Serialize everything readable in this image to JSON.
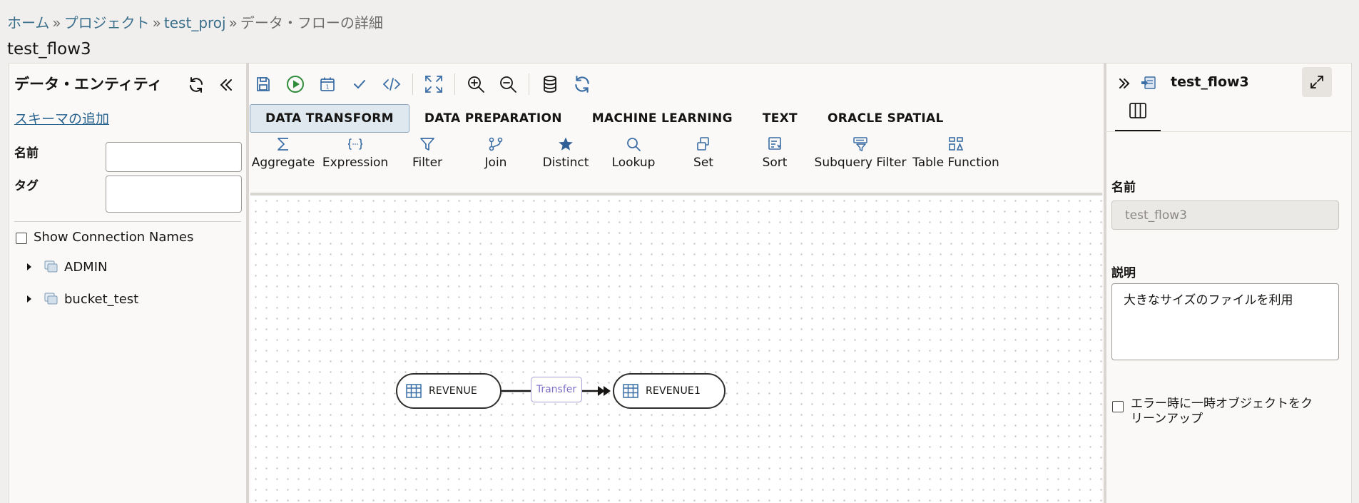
{
  "breadcrumb": {
    "home": "ホーム",
    "projects": "プロジェクト",
    "project": "test_proj",
    "current": "データ・フローの詳細",
    "separator": "»"
  },
  "page_title": "test_flow3",
  "left_panel": {
    "title": "データ・エンティティ",
    "add_schema": "スキーマの追加",
    "name_label": "名前",
    "name_value": "",
    "tag_label": "タグ",
    "tag_value": "",
    "show_connection_names": "Show Connection Names",
    "tree": [
      {
        "label": "ADMIN"
      },
      {
        "label": "bucket_test"
      }
    ]
  },
  "toolbar": {
    "icons": [
      "save-icon",
      "run-icon",
      "schedule-icon",
      "validate-icon",
      "code-icon",
      "fit-to-screen-icon",
      "zoom-in-icon",
      "zoom-out-icon",
      "database-icon",
      "refresh-icon"
    ]
  },
  "tabs": [
    "DATA TRANSFORM",
    "DATA PREPARATION",
    "MACHINE LEARNING",
    "TEXT",
    "ORACLE SPATIAL"
  ],
  "active_tab": "DATA TRANSFORM",
  "palette": [
    {
      "label": "Aggregate",
      "icon": "sigma-icon"
    },
    {
      "label": "Expression",
      "icon": "expression-icon"
    },
    {
      "label": "Filter",
      "icon": "filter-icon"
    },
    {
      "label": "Join",
      "icon": "join-icon"
    },
    {
      "label": "Distinct",
      "icon": "star-icon"
    },
    {
      "label": "Lookup",
      "icon": "search-icon"
    },
    {
      "label": "Set",
      "icon": "set-icon"
    },
    {
      "label": "Sort",
      "icon": "sort-icon"
    },
    {
      "label": "Subquery Filter",
      "icon": "subquery-filter-icon"
    },
    {
      "label": "Table Function",
      "icon": "table-function-icon"
    }
  ],
  "canvas": {
    "source_node": "REVENUE",
    "link_label": "Transfer",
    "target_node": "REVENUE1"
  },
  "right_panel": {
    "title": "test_flow3",
    "name_label": "名前",
    "name_value": "test_flow3",
    "description_label": "説明",
    "description_value": "大きなサイズのファイルを利用",
    "cleanup_label_1": "エラー時に一時オブジェクトをク",
    "cleanup_label_2": "リーンアップ"
  },
  "colors": {
    "accent_blue": "#3a6ea5",
    "run_green": "#2e8b3a",
    "link": "#2a6590",
    "transfer": "#7b6fc9"
  }
}
